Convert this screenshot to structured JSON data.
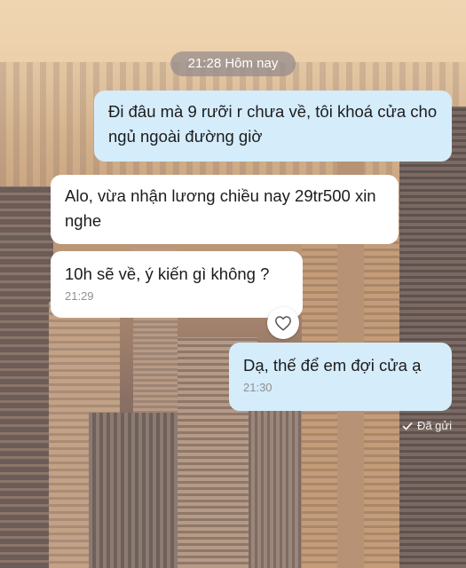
{
  "chat": {
    "date_separator": "21:28 Hôm nay",
    "messages": [
      {
        "direction": "outgoing",
        "text": "Đi đâu mà 9 rưỡi r chưa về, tôi khoá cửa cho ngủ ngoài đường giờ"
      },
      {
        "direction": "incoming",
        "text": "Alo, vừa nhận lương chiều nay 29tr500 xin nghe"
      },
      {
        "direction": "incoming",
        "text": "10h sẽ về, ý kiến gì không ?",
        "time": "21:29",
        "reaction": "heart-icon"
      },
      {
        "direction": "outgoing",
        "text": "Dạ, thế để em đợi cửa ạ",
        "time": "21:30"
      }
    ],
    "status": {
      "label": "Đã gửi",
      "icon": "check-icon"
    }
  },
  "colors": {
    "outgoing_bubble": "#d5ecfb",
    "incoming_bubble": "#ffffff",
    "timestamp": "#8f8f8f"
  }
}
